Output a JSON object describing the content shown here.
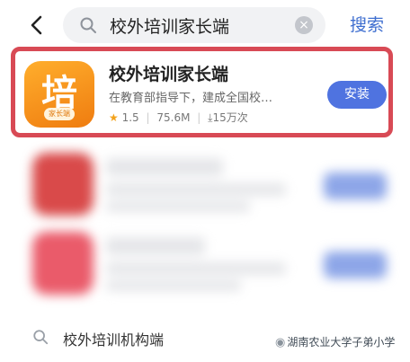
{
  "search": {
    "query": "校外培训家长端",
    "submit_label": "搜索"
  },
  "result": {
    "app_name": "校外培训家长端",
    "icon_char": "培",
    "icon_badge": "家长端",
    "description": "在教育部指导下，建成全国校…",
    "rating": "1.5",
    "size": "75.6M",
    "downloads": "15万次",
    "install_label": "安装"
  },
  "suggestion": {
    "text": "校外培训机构端"
  },
  "watermark": {
    "text": "湖南农业大学子弟小学"
  },
  "colors": {
    "accent": "#4f73e0",
    "highlight_border": "#d84a55",
    "icon_orange": "#f28a14"
  }
}
